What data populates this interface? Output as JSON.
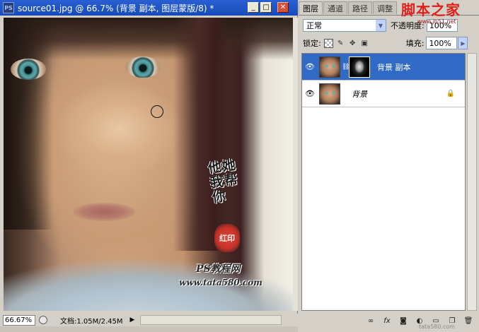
{
  "document": {
    "title": "source01.jpg @ 66.7% (背景 副本, 图层蒙版/8) *",
    "app_icon": "PS",
    "window_buttons": {
      "minimize": "_",
      "maximize": "□",
      "close": "✕"
    },
    "watermark": {
      "calligraphy": "他她我帮你",
      "seal": "红印",
      "ps_tutorial": "PS教程网",
      "url": "www.tata580.com"
    },
    "status": {
      "zoom": "66.67%",
      "info": "文档:1.05M/2.45M",
      "arrow": "▶"
    }
  },
  "layers_panel": {
    "tabs": [
      {
        "label": "图层",
        "active": true
      },
      {
        "label": "通道",
        "active": false
      },
      {
        "label": "路径",
        "active": false
      },
      {
        "label": "调整",
        "active": false
      }
    ],
    "site_logo": "脚本之家",
    "site_url": "www.jb51.net",
    "blend_mode": "正常",
    "opacity_label": "不透明度:",
    "opacity": "100%",
    "lock_label": "锁定:",
    "fill_label": "填充:",
    "fill": "100%",
    "layers": [
      {
        "name": "背景 副本",
        "visible": true,
        "has_mask": true,
        "selected": true
      },
      {
        "name": "背景",
        "visible": true,
        "locked": true,
        "selected": false
      }
    ],
    "footer_watermark": "tata580.com"
  },
  "colors": {
    "titlebar": "#2a5fd3",
    "selection": "#316ac5",
    "panel_bg": "#d4d0c8",
    "site_logo": "#e0201b"
  }
}
